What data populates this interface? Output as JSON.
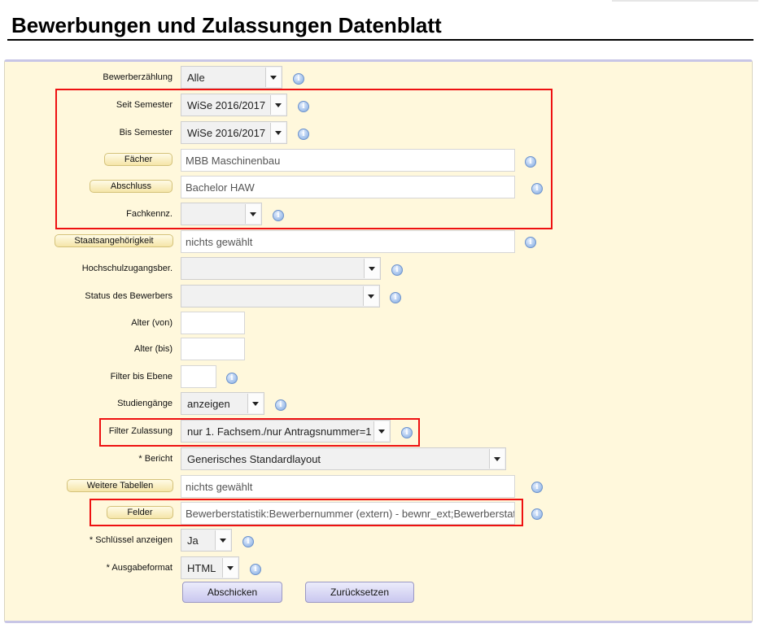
{
  "title": "Bewerbungen und Zulassungen Datenblatt",
  "fields": {
    "bewerberzaehlung": {
      "label": "Bewerberzählung",
      "value": "Alle"
    },
    "seit_semester": {
      "label": "Seit Semester",
      "value": "WiSe 2016/2017"
    },
    "bis_semester": {
      "label": "Bis Semester",
      "value": "WiSe 2016/2017"
    },
    "faecher": {
      "button": "Fächer",
      "value": "MBB Maschinenbau"
    },
    "abschluss": {
      "button": "Abschluss",
      "value": "Bachelor HAW"
    },
    "fachkennz": {
      "label": "Fachkennz.",
      "value": ""
    },
    "staatsangehoerigkeit": {
      "button": "Staatsangehörigkeit",
      "value": "nichts gewählt"
    },
    "hochschulzugangsber": {
      "label": "Hochschulzugangsber.",
      "value": ""
    },
    "status_bewerber": {
      "label": "Status des Bewerbers",
      "value": ""
    },
    "alter_von": {
      "label": "Alter (von)",
      "value": ""
    },
    "alter_bis": {
      "label": "Alter (bis)",
      "value": ""
    },
    "filter_ebene": {
      "label": "Filter bis Ebene",
      "value": ""
    },
    "studiengaenge": {
      "label": "Studiengänge",
      "value": "anzeigen"
    },
    "filter_zulassung": {
      "label": "Filter Zulassung",
      "value": "nur 1. Fachsem./nur Antragsnummer=1"
    },
    "bericht": {
      "label": "* Bericht",
      "value": "Generisches Standardlayout"
    },
    "weitere_tabellen": {
      "button": "Weitere Tabellen",
      "value": "nichts gewählt"
    },
    "felder": {
      "button": "Felder",
      "value": "Bewerberstatistik:Bewerbernummer (extern) - bewnr_ext;Bewerberstatistik"
    },
    "schluessel": {
      "label": "* Schlüssel anzeigen",
      "value": "Ja"
    },
    "ausgabeformat": {
      "label": "* Ausgabeformat",
      "value": "HTML"
    }
  },
  "actions": {
    "submit": "Abschicken",
    "reset": "Zurücksetzen"
  },
  "info_glyph": "i",
  "icons": {
    "info": "info-icon",
    "dropdown": "chevron-down-icon"
  },
  "colors": {
    "panel_bg": "#fff8dc",
    "highlight": "#ee1111",
    "field_button": "#f5e5a8",
    "submit_button": "#c9c7ef"
  }
}
